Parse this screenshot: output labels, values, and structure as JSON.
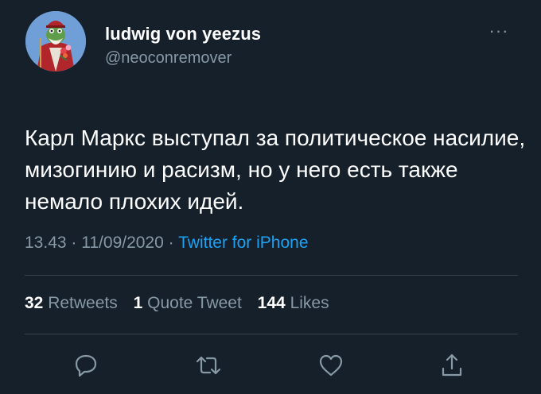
{
  "user": {
    "display_name": "ludwig von yeezus",
    "handle": "@neoconremover"
  },
  "tweet": {
    "text": "Карл Маркс выступал за политическое насилие, мизогинию и расизм, но у него есть также немало плохих идей.",
    "time": "13.43",
    "separator": "·",
    "date": "11/09/2020",
    "source": "Twitter for iPhone"
  },
  "stats": {
    "retweets_count": "32",
    "retweets_label": "Retweets",
    "quotes_count": "1",
    "quotes_label": "Quote Tweet",
    "likes_count": "144",
    "likes_label": "Likes"
  },
  "menu": {
    "more_glyph": "···"
  },
  "icons": {
    "reply": "reply-icon",
    "retweet": "retweet-icon",
    "like": "heart-icon",
    "share": "share-icon",
    "more": "more-icon"
  },
  "colors": {
    "background": "#15202b",
    "secondary_text": "#8899a6",
    "link": "#1da1f2",
    "divider": "#38444d"
  }
}
